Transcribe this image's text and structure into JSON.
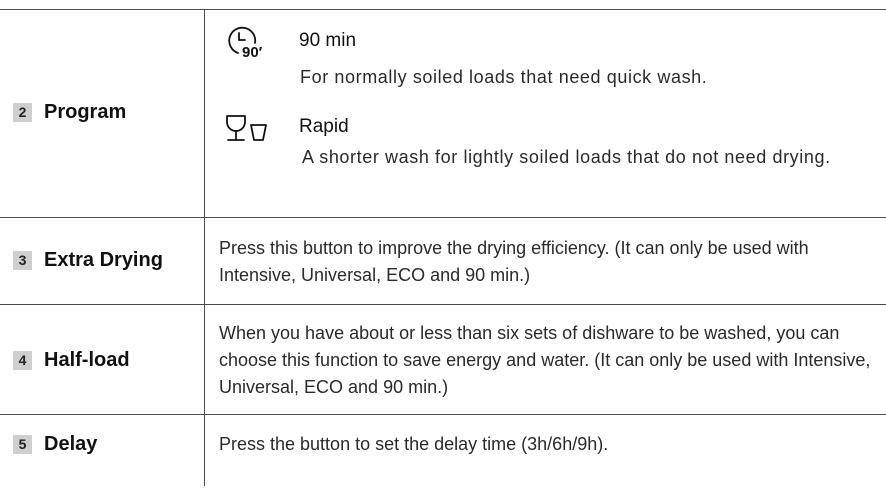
{
  "rows": [
    {
      "number": "2",
      "label": "Program",
      "programs": [
        {
          "icon": "clock-90-icon",
          "name": "90 min",
          "icon_text": "90′",
          "description": "For normally soiled loads that need quick wash."
        },
        {
          "icon": "glass-cup-icon",
          "name": "Rapid",
          "description": "A shorter wash for lightly soiled loads that do not need drying."
        }
      ]
    },
    {
      "number": "3",
      "label": "Extra Drying",
      "description": "Press this button to improve the drying efficiency. (It can only be used with Intensive, Universal, ECO and 90 min.)"
    },
    {
      "number": "4",
      "label": "Half-load",
      "description": "When you have about or less than six sets of dishware to be washed, you can choose this function to save energy and water. (It can only be used with Intensive, Universal, ECO and 90 min.)"
    },
    {
      "number": "5",
      "label": "Delay",
      "description": "Press the button to set the delay time (3h/6h/9h)."
    }
  ]
}
